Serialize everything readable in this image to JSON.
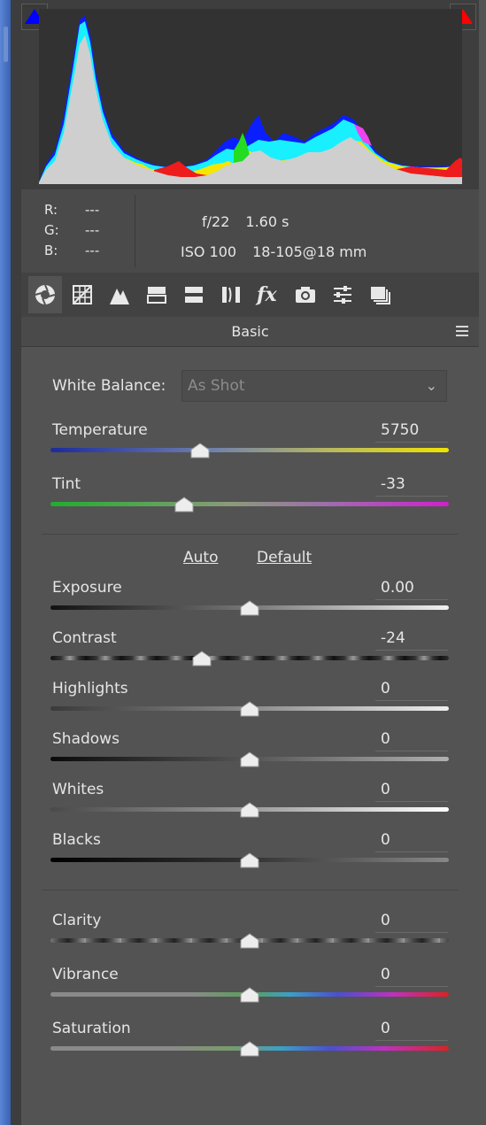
{
  "histogram": {
    "shadow_clip_color": "#0000ff",
    "highlight_clip_color": "#ff0000"
  },
  "readout": {
    "r_label": "R:",
    "r_value": "---",
    "g_label": "G:",
    "g_value": "---",
    "b_label": "B:",
    "b_value": "---",
    "aperture": "f/22",
    "shutter": "1.60 s",
    "iso": "ISO 100",
    "lens": "18-105@18 mm"
  },
  "tabs": [
    {
      "icon": "aperture-icon",
      "active": true
    },
    {
      "icon": "grid-icon"
    },
    {
      "icon": "mountains-icon"
    },
    {
      "icon": "split-bars-icon"
    },
    {
      "icon": "split-toning-icon"
    },
    {
      "icon": "lens-correction-icon"
    },
    {
      "icon": "fx-icon"
    },
    {
      "icon": "camera-icon"
    },
    {
      "icon": "sliders-icon"
    },
    {
      "icon": "presets-icon"
    }
  ],
  "section": {
    "title": "Basic"
  },
  "white_balance": {
    "label": "White Balance:",
    "value": "As Shot"
  },
  "auto_label": "Auto",
  "default_label": "Default",
  "sliders": {
    "temperature": {
      "label": "Temperature",
      "value": "5750",
      "position": 0.375
    },
    "tint": {
      "label": "Tint",
      "value": "-33",
      "position": 0.335
    },
    "exposure": {
      "label": "Exposure",
      "value": "0.00",
      "position": 0.5
    },
    "contrast": {
      "label": "Contrast",
      "value": "-24",
      "position": 0.38
    },
    "highlights": {
      "label": "Highlights",
      "value": "0",
      "position": 0.5
    },
    "shadows": {
      "label": "Shadows",
      "value": "0",
      "position": 0.5
    },
    "whites": {
      "label": "Whites",
      "value": "0",
      "position": 0.5
    },
    "blacks": {
      "label": "Blacks",
      "value": "0",
      "position": 0.5
    },
    "clarity": {
      "label": "Clarity",
      "value": "0",
      "position": 0.5
    },
    "vibrance": {
      "label": "Vibrance",
      "value": "0",
      "position": 0.5
    },
    "saturation": {
      "label": "Saturation",
      "value": "0",
      "position": 0.5
    }
  }
}
